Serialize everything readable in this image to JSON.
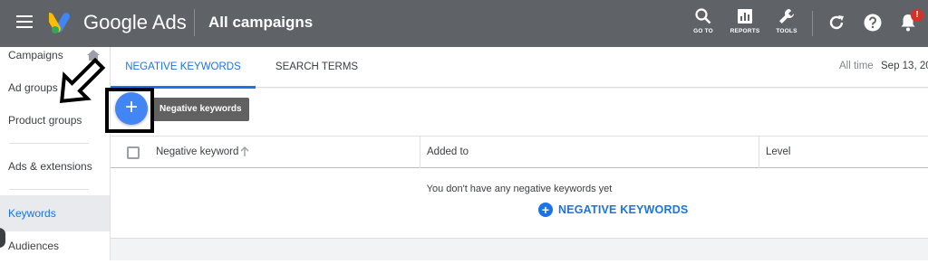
{
  "header": {
    "brand": "Google Ads",
    "title": "All campaigns",
    "tools": [
      {
        "label": "GO TO",
        "icon": "search-icon"
      },
      {
        "label": "REPORTS",
        "icon": "reports-icon"
      },
      {
        "label": "TOOLS",
        "icon": "wrench-icon"
      }
    ],
    "notification_badge": "!"
  },
  "sidebar": {
    "items": [
      {
        "label": "Campaigns"
      },
      {
        "label": "Ad groups"
      },
      {
        "label": "Product groups"
      },
      {
        "label": "Ads & extensions"
      },
      {
        "label": "Keywords",
        "active": true
      },
      {
        "label": "Audiences"
      }
    ]
  },
  "tabs": [
    {
      "label": "NEGATIVE KEYWORDS",
      "active": true
    },
    {
      "label": "SEARCH TERMS"
    }
  ],
  "date_range": {
    "label": "All time",
    "value": "Sep 13, 20"
  },
  "fab_tooltip": "Negative keywords",
  "table": {
    "columns": [
      "Negative keyword",
      "Added to",
      "Level"
    ]
  },
  "empty_state": {
    "message": "You don't have any negative keywords yet",
    "action_label": "NEGATIVE KEYWORDS"
  },
  "colors": {
    "topbar": "#5f6368",
    "accent": "#1a73e8",
    "fab": "#4285f4",
    "badge": "#d93025"
  }
}
